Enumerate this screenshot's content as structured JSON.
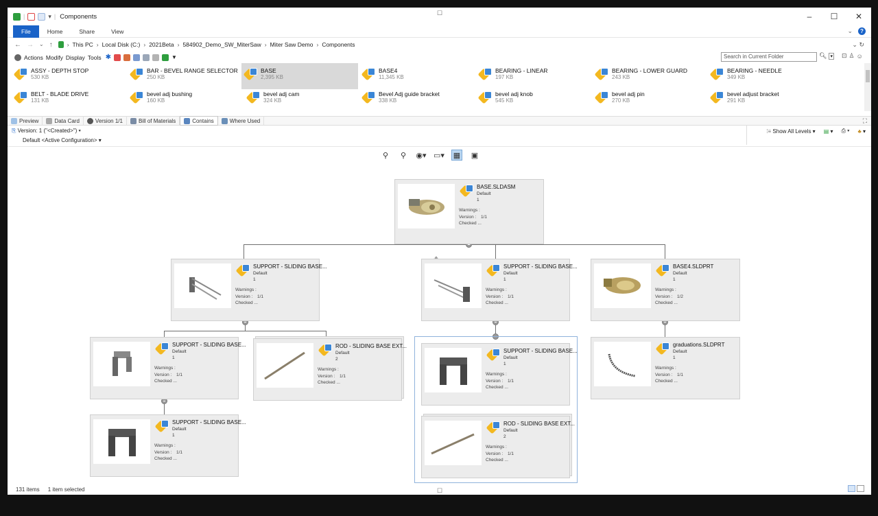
{
  "window": {
    "title": "Components",
    "controls": [
      "–",
      "☐",
      "✕"
    ]
  },
  "ribbon": {
    "tabs": [
      "File",
      "Home",
      "Share",
      "View"
    ]
  },
  "address": {
    "breadcrumbs": [
      "This PC",
      "Local Disk (C:)",
      "2021Beta",
      "584902_Demo_SW_MiterSaw",
      "Miter Saw Demo",
      "Components"
    ]
  },
  "pdm_toolbar": {
    "menus": [
      "Actions",
      "Modify",
      "Display",
      "Tools"
    ],
    "search_placeholder": "Search in Current Folder"
  },
  "files": [
    {
      "name": "ASSY - DEPTH STOP",
      "size": "530 KB"
    },
    {
      "name": "BAR - BEVEL RANGE SELECTOR",
      "size": "250 KB"
    },
    {
      "name": "BASE",
      "size": "2,395 KB",
      "selected": true
    },
    {
      "name": "BASE4",
      "size": "11,345 KB"
    },
    {
      "name": "BEARING - LINEAR",
      "size": "197 KB"
    },
    {
      "name": "BEARING - LOWER GUARD",
      "size": "243 KB"
    },
    {
      "name": "BEARING - NEEDLE",
      "size": "349 KB"
    },
    {
      "name": "BELT - BLADE DRIVE",
      "size": "131 KB"
    },
    {
      "name": "bevel adj bushing",
      "size": "160 KB"
    },
    {
      "name": "bevel adj cam",
      "size": "324 KB"
    },
    {
      "name": "Bevel Adj guide bracket",
      "size": "338 KB"
    },
    {
      "name": "bevel adj knob",
      "size": "545 KB"
    },
    {
      "name": "bevel adj pin",
      "size": "270 KB"
    },
    {
      "name": "bevel adjust bracket",
      "size": "291 KB"
    }
  ],
  "view_tabs": [
    "Preview",
    "Data Card",
    "Version 1/1",
    "Bill of Materials",
    "Contains",
    "Where Used"
  ],
  "active_tab": "Contains",
  "version_line": "Version: 1 (\"<Created>\")",
  "config_line": "Default <Active Configuration>",
  "show_levels": "Show All Levels",
  "nodes": [
    {
      "name": "BASE.SLDASM",
      "config": "Default",
      "qty": "1",
      "version": "1/1"
    },
    {
      "name": "SUPPORT - SLIDING BASE...",
      "config": "Default",
      "qty": "1",
      "version": "1/1"
    },
    {
      "name": "SUPPORT - SLIDING BASE...",
      "config": "Default",
      "qty": "1",
      "version": "1/1"
    },
    {
      "name": "BASE4.SLDPRT",
      "config": "Default",
      "qty": "1",
      "version": "1/2"
    },
    {
      "name": "SUPPORT - SLIDING BASE...",
      "config": "Default",
      "qty": "1",
      "version": "1/1"
    },
    {
      "name": "ROD - SLIDING BASE EXT...",
      "config": "Default",
      "qty": "2",
      "version": "1/1"
    },
    {
      "name": "SUPPORT - SLIDING BASE...",
      "config": "Default",
      "qty": "1",
      "version": "1/1"
    },
    {
      "name": "graduations.SLDPRT",
      "config": "Default",
      "qty": "1",
      "version": "1/1"
    },
    {
      "name": "SUPPORT - SLIDING BASE...",
      "config": "Default",
      "qty": "1",
      "version": "1/1"
    },
    {
      "name": "ROD - SLIDING BASE EXT...",
      "config": "Default",
      "qty": "2",
      "version": "1/1"
    }
  ],
  "node_labels": {
    "warnings": "Warnings :",
    "version": "Version :",
    "checked": "Checked ..."
  },
  "status": {
    "items": "131 items",
    "selected": "1 item selected"
  }
}
